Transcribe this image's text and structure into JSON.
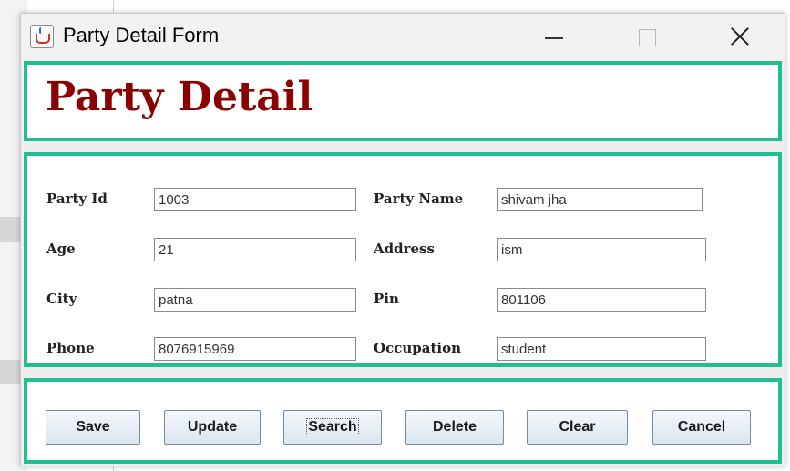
{
  "window": {
    "title": "Party Detail Form"
  },
  "header": {
    "heading": "Party Detail"
  },
  "form": {
    "fields": [
      {
        "label": "Party Id",
        "value": "1003"
      },
      {
        "label": "Party Name",
        "value": "shivam jha"
      },
      {
        "label": "Age",
        "value": "21"
      },
      {
        "label": "Address",
        "value": "ism"
      },
      {
        "label": "City",
        "value": "patna"
      },
      {
        "label": "Pin",
        "value": "801106"
      },
      {
        "label": "Phone",
        "value": "8076915969"
      },
      {
        "label": "Occupation",
        "value": "student"
      }
    ]
  },
  "buttons": {
    "save": "Save",
    "update": "Update",
    "search": "Search",
    "delete": "Delete",
    "clear": "Clear",
    "cancel": "Cancel"
  },
  "colors": {
    "panel_border": "#1fbf8f",
    "heading": "#8b0000"
  },
  "icons": {
    "app": "java-cup-icon",
    "minimize": "minimize-icon",
    "maximize": "maximize-icon",
    "close": "close-icon"
  }
}
